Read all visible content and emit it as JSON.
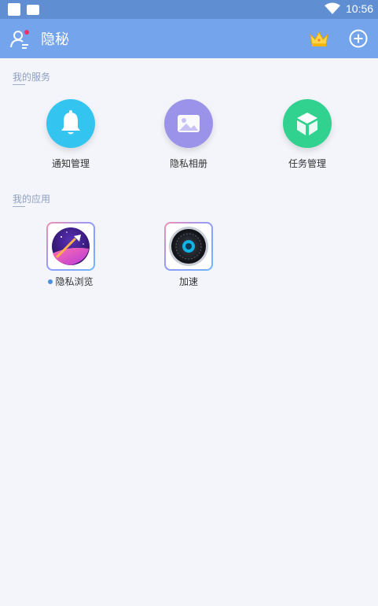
{
  "status_bar": {
    "time": "10:56"
  },
  "header": {
    "title": "隐秘",
    "icons": [
      "user-icon",
      "crown-icon",
      "add-icon"
    ]
  },
  "services": {
    "title": "我的服务",
    "items": [
      {
        "label": "通知管理",
        "icon": "bell-icon",
        "color": "#33c5f0"
      },
      {
        "label": "隐私相册",
        "icon": "photo-icon",
        "color": "#9b93ea"
      },
      {
        "label": "任务管理",
        "icon": "cube-icon",
        "color": "#31d18f"
      }
    ]
  },
  "apps": {
    "title": "我的应用",
    "items": [
      {
        "label": "隐私浏览",
        "icon": "rocket-icon",
        "new_dot": true
      },
      {
        "label": "加速",
        "icon": "turbine-icon",
        "new_dot": false
      }
    ]
  },
  "colors": {
    "header": "#74a4ec",
    "status_bar": "#5f8ed3",
    "background": "#f3f5fa"
  }
}
